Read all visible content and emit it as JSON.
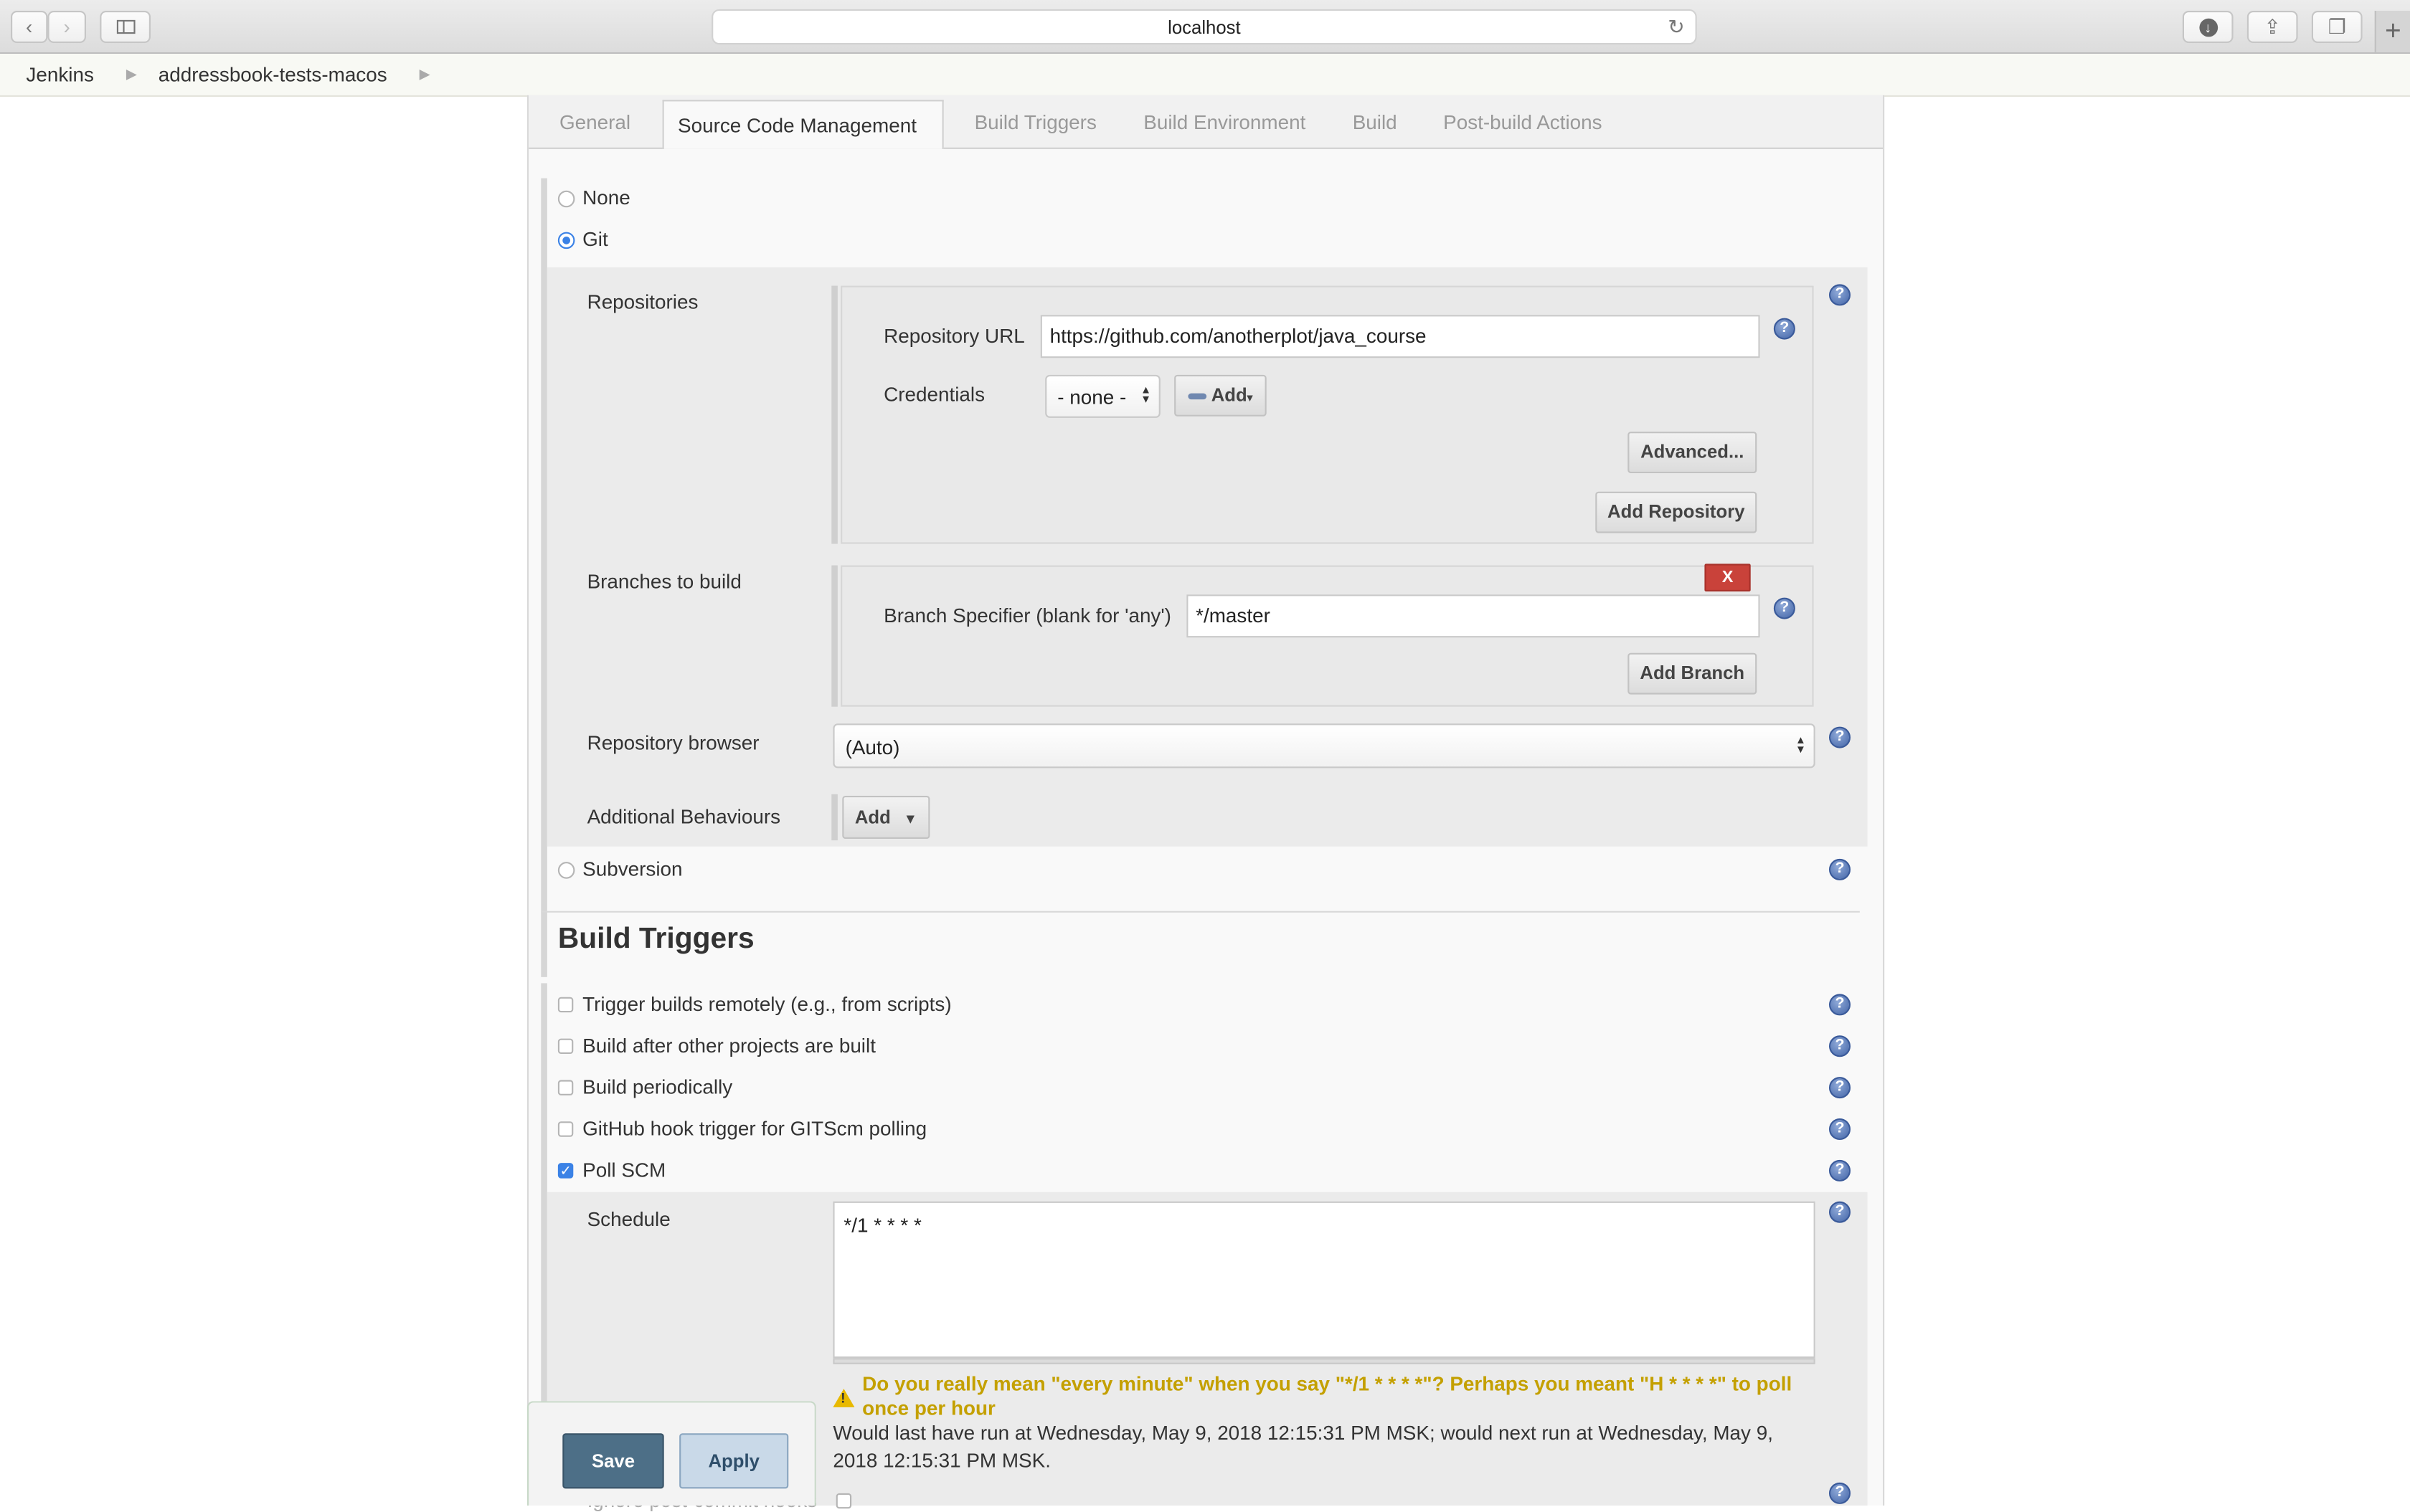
{
  "browser": {
    "url": "localhost",
    "icons": {
      "back": "chevron-left-icon",
      "forward": "chevron-right-icon",
      "sidebar": "sidebar-icon",
      "reload": "reload-icon",
      "download": "download-icon",
      "share": "share-icon",
      "tabs": "tabs-icon",
      "new_tab": "plus-icon"
    }
  },
  "breadcrumb": [
    "Jenkins",
    "addressbook-tests-macos"
  ],
  "tabs": [
    {
      "label": "General",
      "active": false
    },
    {
      "label": "Source Code Management",
      "active": true
    },
    {
      "label": "Build Triggers",
      "active": false
    },
    {
      "label": "Build Environment",
      "active": false
    },
    {
      "label": "Build",
      "active": false
    },
    {
      "label": "Post-build Actions",
      "active": false
    }
  ],
  "scm": {
    "options": [
      "None",
      "Git",
      "Subversion"
    ],
    "selected": "Git",
    "repositories_label": "Repositories",
    "repository_url_label": "Repository URL",
    "repository_url_value": "https://github.com/anotherplot/java_course",
    "credentials_label": "Credentials",
    "credentials_value": "- none -",
    "add_credentials_label": "Add",
    "advanced_label": "Advanced...",
    "add_repository_label": "Add Repository",
    "branches_label": "Branches to build",
    "delete_branch_label": "X",
    "branch_specifier_label": "Branch Specifier (blank for 'any')",
    "branch_specifier_value": "*/master",
    "add_branch_label": "Add Branch",
    "repo_browser_label": "Repository browser",
    "repo_browser_value": "(Auto)",
    "additional_behaviours_label": "Additional Behaviours",
    "add_behaviour_label": "Add"
  },
  "build_triggers": {
    "heading": "Build Triggers",
    "options": [
      {
        "label": "Trigger builds remotely (e.g., from scripts)",
        "checked": false
      },
      {
        "label": "Build after other projects are built",
        "checked": false
      },
      {
        "label": "Build periodically",
        "checked": false
      },
      {
        "label": "GitHub hook trigger for GITScm polling",
        "checked": false
      },
      {
        "label": "Poll SCM",
        "checked": true
      }
    ],
    "schedule_label": "Schedule",
    "schedule_value": "*/1 * * * *",
    "warning": "Do you really mean \"every minute\" when you say \"*/1 * * * *\"? Perhaps you meant \"H * * * *\" to poll once per hour",
    "info": "Would last have run at Wednesday, May 9, 2018 12:15:31 PM MSK; would next run at Wednesday, May 9, 2018 12:15:31 PM MSK.",
    "ignore_hooks_label": "Ignore post-commit hooks"
  },
  "actions": {
    "save_label": "Save",
    "apply_label": "Apply"
  },
  "colors": {
    "save_button": "#4d6f87",
    "apply_button": "#c9d9e8",
    "delete_button": "#c9423a",
    "warning_text": "#c4a000",
    "help_icon": "#4466a8"
  }
}
